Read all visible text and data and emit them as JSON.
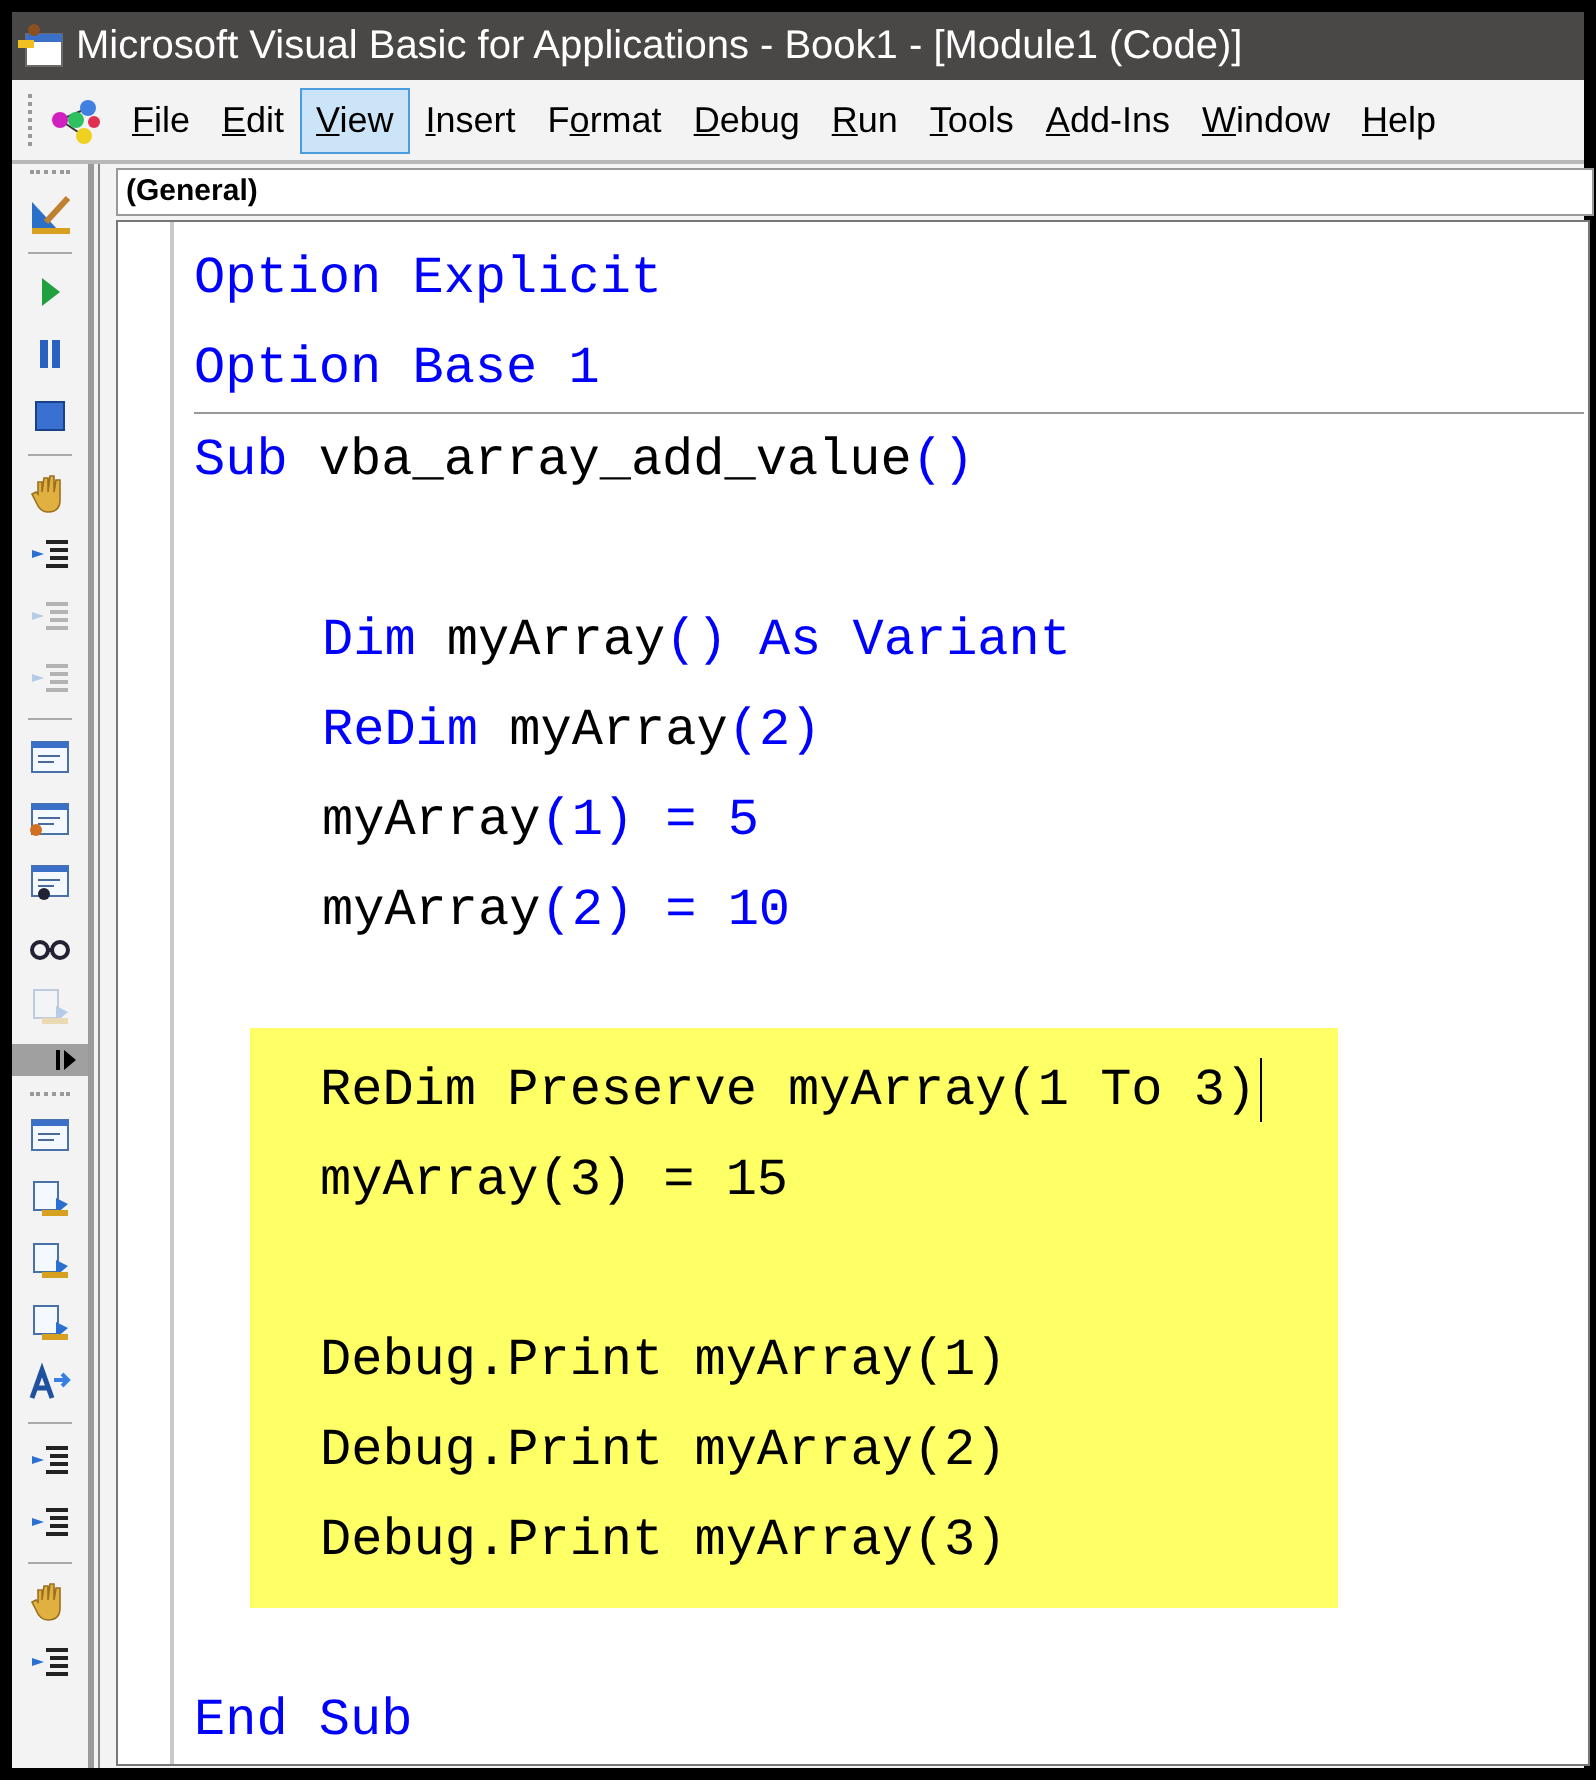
{
  "window": {
    "title": "Microsoft Visual Basic for Applications - Book1 - [Module1 (Code)]"
  },
  "menu": [
    {
      "key": "F",
      "after": "ile",
      "selected": false
    },
    {
      "key": "E",
      "after": "dit",
      "selected": false
    },
    {
      "key": "V",
      "after": "iew",
      "selected": true
    },
    {
      "key": "I",
      "after": "nsert",
      "selected": false
    },
    {
      "before": "F",
      "key": "o",
      "after": "rmat",
      "selected": false
    },
    {
      "key": "D",
      "after": "ebug",
      "selected": false
    },
    {
      "key": "R",
      "after": "un",
      "selected": false
    },
    {
      "key": "T",
      "after": "ools",
      "selected": false
    },
    {
      "key": "A",
      "after": "dd-Ins",
      "selected": false
    },
    {
      "key": "W",
      "after": "indow",
      "selected": false
    },
    {
      "key": "H",
      "after": "elp",
      "selected": false
    }
  ],
  "toolbar": [
    {
      "disabled": false
    },
    {
      "disabled": false
    },
    {
      "disabled": false
    },
    {
      "disabled": false
    },
    {
      "disabled": false
    },
    {
      "disabled": false
    },
    {
      "disabled": true
    },
    {
      "disabled": true
    },
    {
      "disabled": false
    },
    {
      "disabled": false
    },
    {
      "disabled": false
    },
    {
      "disabled": false
    },
    {
      "disabled": true
    },
    {
      "disabled": false
    },
    {
      "disabled": false
    },
    {
      "disabled": false
    },
    {
      "disabled": false
    },
    {
      "disabled": false
    },
    {
      "disabled": false
    },
    {
      "disabled": false
    },
    {
      "disabled": false
    },
    {
      "disabled": false
    }
  ],
  "object_dropdown": {
    "value": "(General)"
  },
  "code": {
    "sections": [
      {
        "kind": "declarations",
        "groups": [
          {
            "highlighted": false,
            "lines": [
              {
                "kind": "code",
                "indented": false,
                "tokens": [
                  {
                    "text": "Option Explicit",
                    "keyword": true
                  }
                ]
              },
              {
                "kind": "code",
                "indented": false,
                "tokens": [
                  {
                    "text": "Option Base 1",
                    "keyword": true
                  }
                ]
              }
            ]
          }
        ]
      },
      {
        "kind": "procedure",
        "groups": [
          {
            "highlighted": false,
            "lines": [
              {
                "kind": "code",
                "indented": false,
                "tokens": [
                  {
                    "text": "Sub",
                    "keyword": true
                  },
                  {
                    "text": "vba_array_add_value",
                    "keyword": false,
                    "gap": true
                  },
                  {
                    "text": "()",
                    "keyword": true
                  }
                ]
              },
              {
                "kind": "blank"
              },
              {
                "kind": "code",
                "indented": true,
                "tokens": [
                  {
                    "text": "Dim",
                    "keyword": true
                  },
                  {
                    "text": "myArray",
                    "keyword": false,
                    "gap": true
                  },
                  {
                    "text": "() As Variant",
                    "keyword": true
                  }
                ]
              },
              {
                "kind": "code",
                "indented": true,
                "tokens": [
                  {
                    "text": "ReDim",
                    "keyword": true
                  },
                  {
                    "text": "myArray",
                    "keyword": false,
                    "gap": true
                  },
                  {
                    "text": "(2)",
                    "keyword": true
                  }
                ]
              },
              {
                "kind": "code",
                "indented": true,
                "tokens": [
                  {
                    "text": "myArray",
                    "keyword": false
                  },
                  {
                    "text": "(1) = 5",
                    "keyword": true
                  }
                ]
              },
              {
                "kind": "code",
                "indented": true,
                "tokens": [
                  {
                    "text": "myArray",
                    "keyword": false
                  },
                  {
                    "text": "(2) = 10",
                    "keyword": true
                  }
                ]
              },
              {
                "kind": "blank"
              }
            ]
          },
          {
            "highlighted": true,
            "lines": [
              {
                "kind": "code",
                "indented": true,
                "caret": true,
                "tokens": [
                  {
                    "text": "ReDim Preserve myArray",
                    "keyword": false
                  },
                  {
                    "text": "(1 To 3)",
                    "keyword": false
                  }
                ]
              },
              {
                "kind": "code",
                "indented": true,
                "tokens": [
                  {
                    "text": "myArray(3) = 15",
                    "keyword": false
                  }
                ]
              },
              {
                "kind": "blank"
              },
              {
                "kind": "code",
                "indented": true,
                "tokens": [
                  {
                    "text": "Debug.Print myArray(1)",
                    "keyword": false
                  }
                ]
              },
              {
                "kind": "code",
                "indented": true,
                "tokens": [
                  {
                    "text": "Debug.Print myArray(2)",
                    "keyword": false
                  }
                ]
              },
              {
                "kind": "code",
                "indented": true,
                "tokens": [
                  {
                    "text": "Debug.Print myArray(3)",
                    "keyword": false
                  }
                ]
              }
            ]
          },
          {
            "highlighted": false,
            "lines": [
              {
                "kind": "blank"
              },
              {
                "kind": "code",
                "indented": false,
                "tokens": [
                  {
                    "text": "End Sub",
                    "keyword": true
                  }
                ]
              }
            ]
          }
        ]
      }
    ]
  }
}
